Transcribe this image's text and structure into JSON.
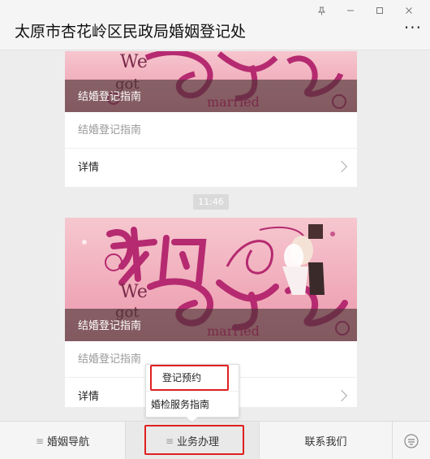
{
  "window": {
    "title": "太原市杏花岭区民政局婚姻登记处",
    "more_label": "···"
  },
  "messages": [
    {
      "banner_caption": "结婚登记指南",
      "description": "结婚登记指南",
      "more_label": "详情"
    },
    {
      "banner_caption": "结婚登记指南",
      "description": "结婚登记指南",
      "more_label": "详情"
    }
  ],
  "timestamp": "11:46",
  "menu": {
    "items": [
      {
        "label": "婚姻导航",
        "icon": "menu-lines-icon"
      },
      {
        "label": "业务办理",
        "icon": "menu-lines-icon"
      },
      {
        "label": "联系我们"
      }
    ],
    "popup": [
      {
        "label": "登记预约"
      },
      {
        "label": "婚检服务指南"
      }
    ]
  },
  "colors": {
    "highlight": "#e02020",
    "banner_pink": "#f0aab9",
    "title_text": "#111111"
  }
}
